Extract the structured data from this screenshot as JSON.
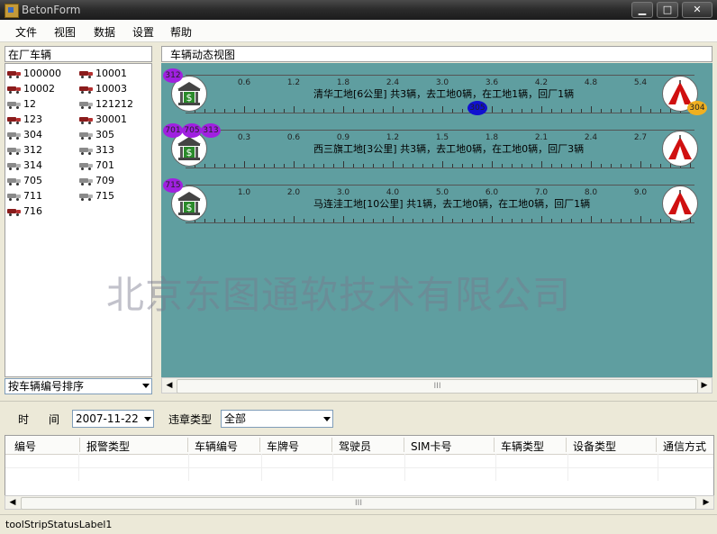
{
  "window": {
    "title": "BetonForm",
    "min": "▁",
    "max": "□",
    "close": "✕"
  },
  "menu": [
    "文件",
    "视图",
    "数据",
    "设置",
    "帮助"
  ],
  "left_panel": {
    "title": "在厂车辆",
    "vehicles": [
      {
        "id": "100000",
        "color": "red"
      },
      {
        "id": "10001",
        "color": "red"
      },
      {
        "id": "10002",
        "color": "red"
      },
      {
        "id": "10003",
        "color": "red"
      },
      {
        "id": "12",
        "color": "gray"
      },
      {
        "id": "121212",
        "color": "gray"
      },
      {
        "id": "123",
        "color": "red"
      },
      {
        "id": "30001",
        "color": "red"
      },
      {
        "id": "304",
        "color": "gray"
      },
      {
        "id": "305",
        "color": "gray"
      },
      {
        "id": "312",
        "color": "gray"
      },
      {
        "id": "313",
        "color": "gray"
      },
      {
        "id": "314",
        "color": "gray"
      },
      {
        "id": "701",
        "color": "gray"
      },
      {
        "id": "705",
        "color": "gray"
      },
      {
        "id": "709",
        "color": "gray"
      },
      {
        "id": "711",
        "color": "gray"
      },
      {
        "id": "715",
        "color": "gray"
      },
      {
        "id": "716",
        "color": "red"
      }
    ],
    "sort_label": "按车辆编号排序"
  },
  "right_panel": {
    "title": "车辆动态视图",
    "watermark": "北京东图通软技术有限公司",
    "tracks": [
      {
        "label": "清华工地[6公里] 共3辆，去工地0辆，在工地1辆，回厂1辆",
        "ticks": [
          "0.6",
          "1.2",
          "1.8",
          "2.4",
          "3.0",
          "3.6",
          "4.2",
          "4.8",
          "5.4"
        ],
        "plant_badges": [
          "312"
        ],
        "moving_badge": "305",
        "site_badge": "304"
      },
      {
        "label": "西三旗工地[3公里] 共3辆，去工地0辆，在工地0辆，回厂3辆",
        "ticks": [
          "0.3",
          "0.6",
          "0.9",
          "1.2",
          "1.5",
          "1.8",
          "2.1",
          "2.4",
          "2.7"
        ],
        "plant_badges": [
          "701",
          "705",
          "313"
        ]
      },
      {
        "label": "马连洼工地[10公里] 共1辆，去工地0辆，在工地0辆，回厂1辆",
        "ticks": [
          "1.0",
          "2.0",
          "3.0",
          "4.0",
          "5.0",
          "6.0",
          "7.0",
          "8.0",
          "9.0"
        ],
        "plant_badges": [
          "715"
        ]
      }
    ],
    "scroll_grip": "III"
  },
  "filter": {
    "time_label_1": "时",
    "time_label_2": "间",
    "date_value": "2007-11-22",
    "violation_label": "违章类型",
    "violation_value": "全部"
  },
  "grid": {
    "columns": [
      "编号",
      "报警类型",
      "车辆编号",
      "车牌号",
      "驾驶员",
      "SIM卡号",
      "车辆类型",
      "设备类型",
      "通信方式"
    ],
    "scroll_grip": "III"
  },
  "status": {
    "text": "toolStripStatusLabel1"
  },
  "colors": {
    "canvas_bg": "#5f9ea0",
    "badge_plant": "#a020e0",
    "badge_moving": "#1010d0",
    "badge_site": "#f0b020"
  }
}
